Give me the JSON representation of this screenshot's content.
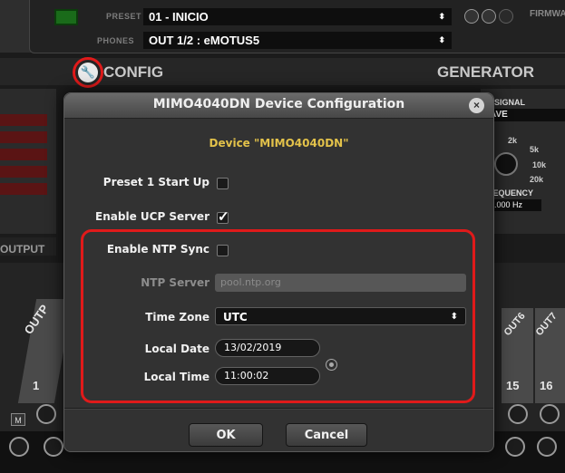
{
  "topbar": {
    "preset_label": "PRESET",
    "preset_value": "01 - INICIO",
    "phones_label": "PHONES",
    "phones_value": "OUT 1/2 : eMOTUS5",
    "firmware_label": "FIRMWA",
    "select_arrow": "⬍"
  },
  "sections": {
    "config": "CONFIG",
    "generator": "GENERATOR",
    "outputs": "OUTPUT"
  },
  "generator": {
    "signal_label": "SIGNAL",
    "wave_value": "AVE",
    "knob_ticks": [
      "2k",
      "5k",
      "10k",
      "20k"
    ],
    "frequency_label": "REQUENCY",
    "frequency_value": "1.000 Hz"
  },
  "channels": {
    "left_tab": "OUTP",
    "right_tabs": [
      "OUT6",
      "OUT7"
    ],
    "left_number": "1",
    "right_numbers": [
      "15",
      "16"
    ],
    "m_label": "M"
  },
  "dialog": {
    "title": "MIMO4040DN Device Configuration",
    "device_line": "Device \"MIMO4040DN\"",
    "preset_startup": {
      "label": "Preset 1 Start Up",
      "checked": false
    },
    "enable_ucp": {
      "label": "Enable UCP Server",
      "checked": true
    },
    "enable_ntp": {
      "label": "Enable NTP Sync",
      "checked": false
    },
    "ntp_server": {
      "label": "NTP Server",
      "value": "pool.ntp.org"
    },
    "time_zone": {
      "label": "Time Zone",
      "value": "UTC"
    },
    "local_date": {
      "label": "Local Date",
      "value": "13/02/2019"
    },
    "local_time": {
      "label": "Local Time",
      "value": "11:00:02"
    },
    "ok_label": "OK",
    "cancel_label": "Cancel"
  },
  "icons": {
    "wrench": "🔧",
    "close": "×"
  },
  "colors": {
    "highlight_red": "#e01a1a",
    "device_yellow": "#e3c24a",
    "panel_bg": "#323232"
  }
}
